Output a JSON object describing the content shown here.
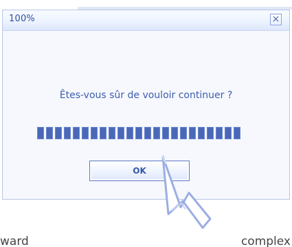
{
  "dialog": {
    "title": "100%",
    "close_symbol": "×",
    "message": "Êtes-vous sûr de vouloir continuer ?",
    "progress_percent": 100,
    "ok_label": "OK"
  },
  "footer": {
    "left_text": "ward",
    "right_text": "complex"
  },
  "icons": {
    "close": "close-icon",
    "cursor": "arrow-cursor-icon"
  },
  "colors": {
    "accent": "#3f5fb0",
    "progress": "#4b68b8",
    "background": "#f6f8fd"
  }
}
